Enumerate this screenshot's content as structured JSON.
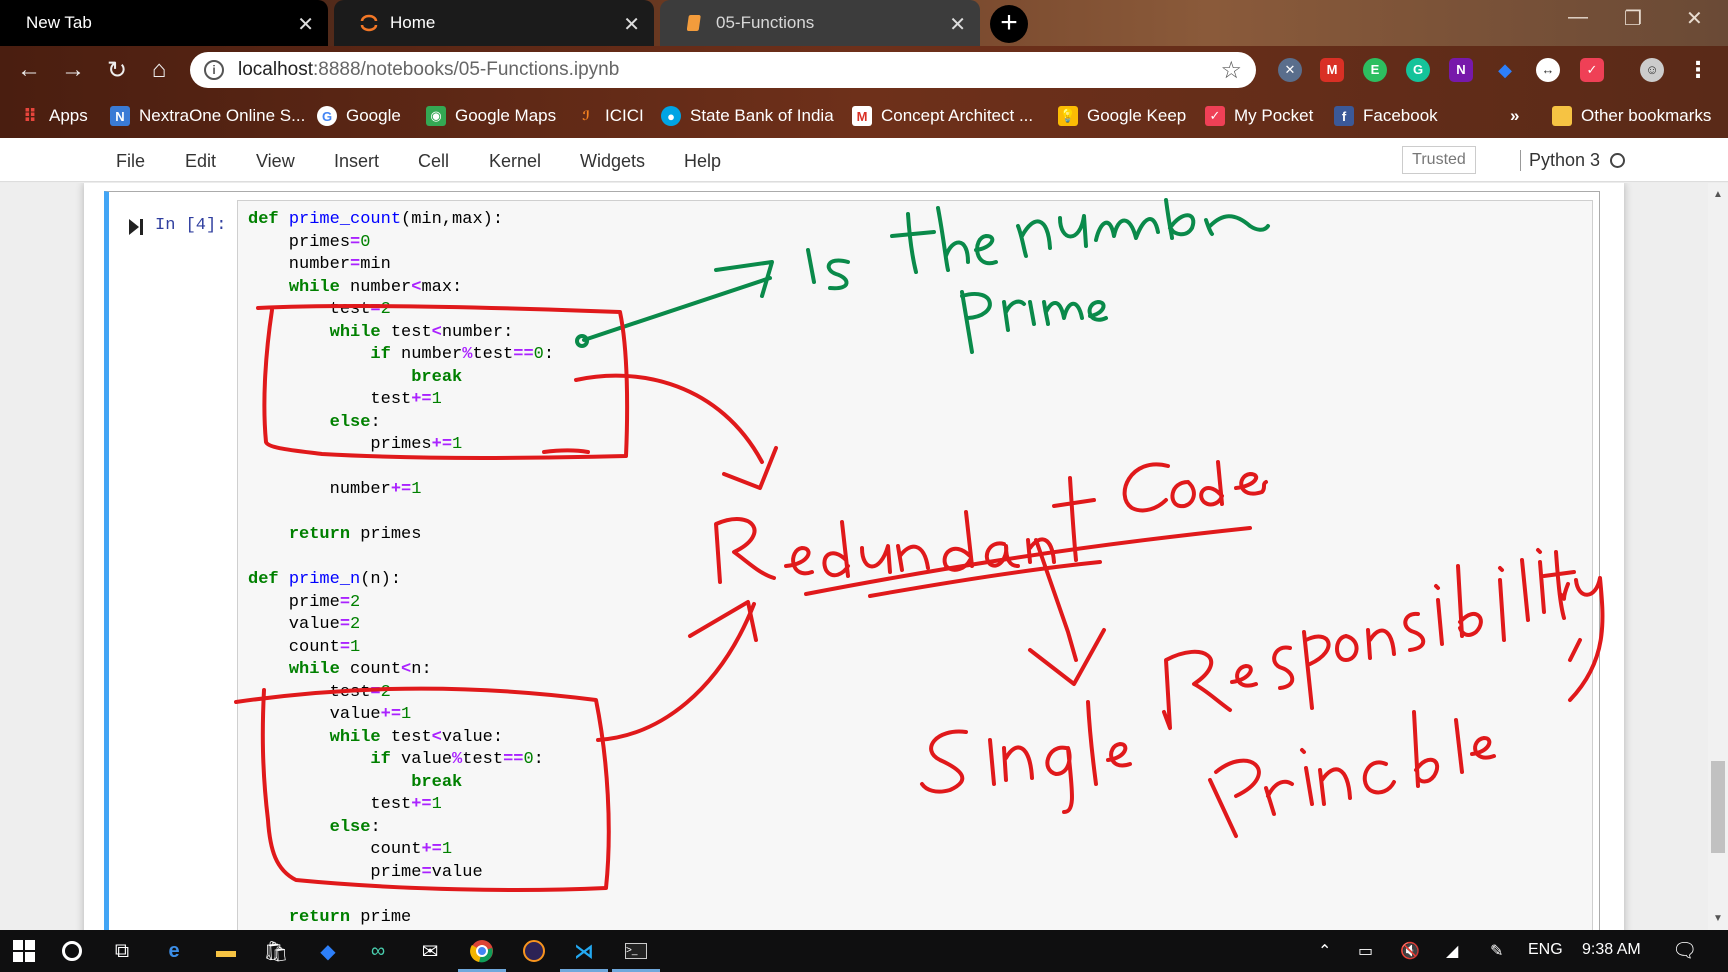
{
  "browser": {
    "tabs": [
      {
        "title": "New Tab"
      },
      {
        "title": "Home"
      },
      {
        "title": "05-Functions"
      }
    ],
    "url_host": "localhost",
    "url_path": ":8888/notebooks/05-Functions.ipynb",
    "bookmarks": [
      {
        "label": "Apps",
        "icon": "apps-grid-icon"
      },
      {
        "label": "NextraOne Online S...",
        "icon": "nextraone-icon"
      },
      {
        "label": "Google",
        "icon": "google-icon"
      },
      {
        "label": "Google Maps",
        "icon": "google-maps-icon"
      },
      {
        "label": "ICICI",
        "icon": "icici-icon"
      },
      {
        "label": "State Bank of India",
        "icon": "sbi-icon"
      },
      {
        "label": "Concept Architect ...",
        "icon": "gmail-icon"
      },
      {
        "label": "Google Keep",
        "icon": "google-keep-icon"
      },
      {
        "label": "My Pocket",
        "icon": "pocket-icon"
      },
      {
        "label": "Facebook",
        "icon": "facebook-icon"
      }
    ],
    "overflow": "»",
    "other_bookmarks": "Other bookmarks"
  },
  "jupyter": {
    "menu": [
      "File",
      "Edit",
      "View",
      "Insert",
      "Cell",
      "Kernel",
      "Widgets",
      "Help"
    ],
    "trusted": "Trusted",
    "kernel": "Python 3"
  },
  "cell": {
    "prompt": "In [4]:"
  },
  "annotations": {
    "ink_colors": {
      "green": "#0a8a4a",
      "red": "#e0191b"
    },
    "texts": [
      "Is the number Prime",
      "Redundant Code",
      "Single Responsibility Principle"
    ]
  },
  "taskbar": {
    "language": "ENG",
    "time": "9:38 AM"
  }
}
